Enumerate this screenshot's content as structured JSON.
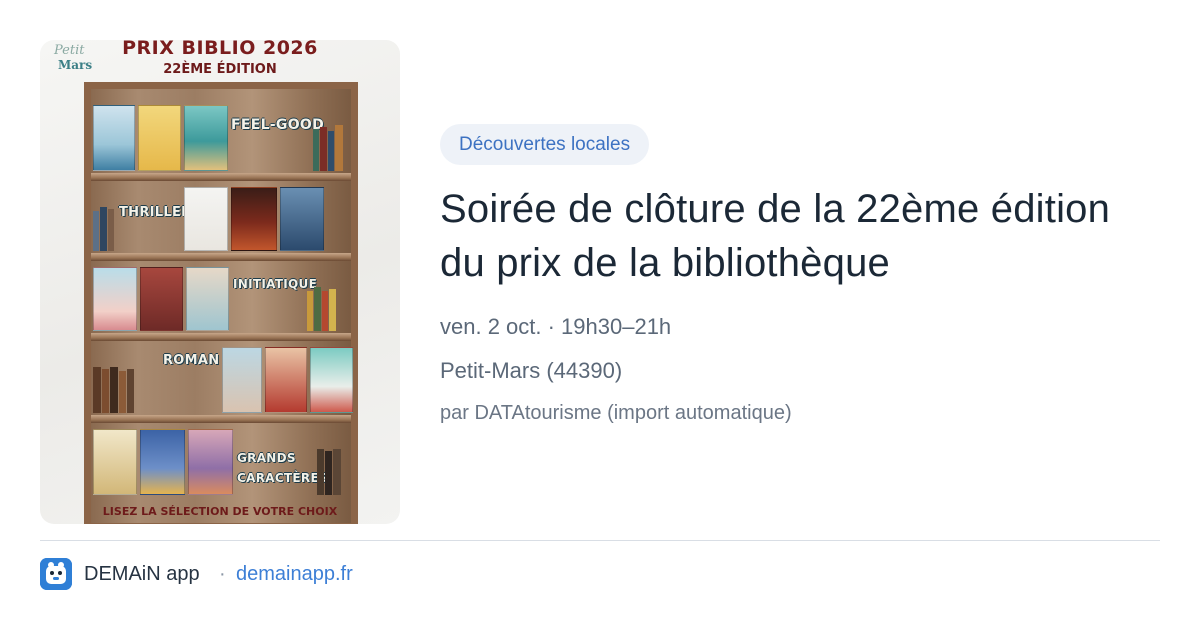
{
  "poster": {
    "logo_line1": "Petit",
    "logo_line2": "Mars",
    "title": "PRIX BIBLIO 2026",
    "edition": "22ÈME ÉDITION",
    "categories": [
      "FEEL-GOOD",
      "THRILLER",
      "INITIATIQUE",
      "ROMAN",
      "GRANDS",
      "CARACTÈRES"
    ],
    "footer": "LISEZ LA SÉLECTION DE VOTRE CHOIX"
  },
  "event": {
    "category_badge": "Découvertes locales",
    "title": "Soirée de clôture de la 22ème édition du prix de la bibliothèque",
    "datetime": "ven. 2 oct. · 19h30–21h",
    "location": "Petit-Mars (44390)",
    "source": "par DATAtourisme (import automatique)"
  },
  "footer": {
    "app_icon": "demain-app-icon",
    "app_name": "DEMAiN app",
    "separator": "·",
    "link": "demainapp.fr"
  },
  "colors": {
    "badge_bg": "#eef2f8",
    "badge_text": "#3d72c2",
    "link": "#3d7fd6",
    "title": "#1b2836",
    "muted": "#5b6878"
  }
}
